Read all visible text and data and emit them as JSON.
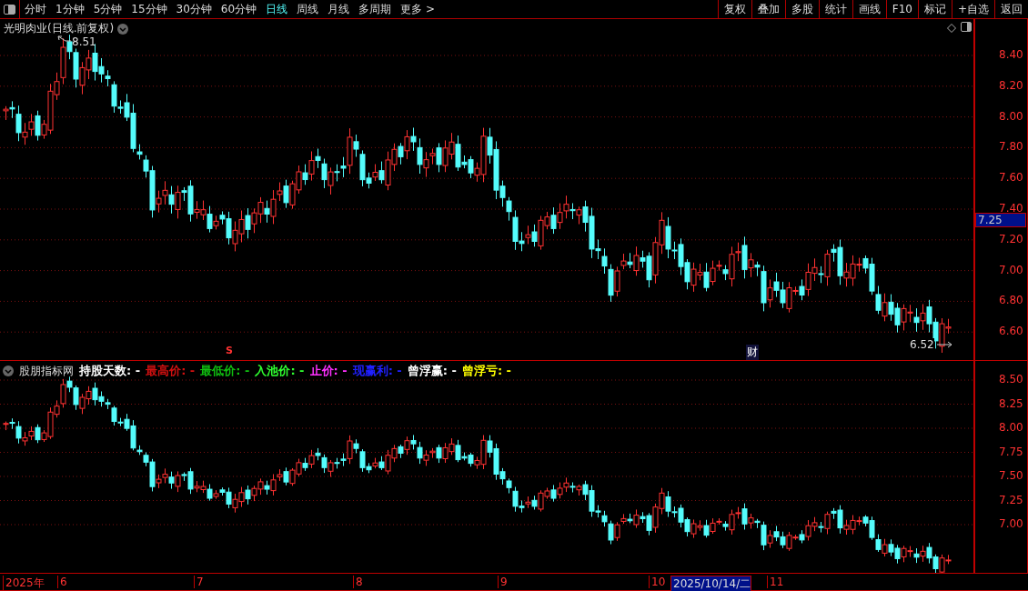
{
  "toolbar": {
    "periods": [
      {
        "label": "分时",
        "selected": false
      },
      {
        "label": "1分钟",
        "selected": false
      },
      {
        "label": "5分钟",
        "selected": false
      },
      {
        "label": "15分钟",
        "selected": false
      },
      {
        "label": "30分钟",
        "selected": false
      },
      {
        "label": "60分钟",
        "selected": false
      },
      {
        "label": "日线",
        "selected": true
      },
      {
        "label": "周线",
        "selected": false
      },
      {
        "label": "月线",
        "selected": false
      },
      {
        "label": "多周期",
        "selected": false
      },
      {
        "label": "更多 >",
        "selected": false
      }
    ],
    "buttons": [
      "复权",
      "叠加",
      "多股",
      "统计",
      "画线",
      "F10",
      "标记",
      "+自选",
      "返回"
    ]
  },
  "main_chart": {
    "title": "光明肉业(日线.前复权)",
    "high_label": "8.51",
    "low_label": "6.52",
    "axis_ticks": [
      "8.40",
      "8.20",
      "8.00",
      "7.80",
      "7.60",
      "7.40",
      "7.20",
      "7.00",
      "6.80",
      "6.60"
    ],
    "current_price": "7.25",
    "event_marks": [
      {
        "kind": "signal",
        "text": "S"
      },
      {
        "kind": "finance",
        "text": "财"
      }
    ]
  },
  "indicator": {
    "name": "股朋指标网",
    "fields": [
      {
        "label": "持股天数: -",
        "color": "#ffffff"
      },
      {
        "label": "最高价: -",
        "color": "#d01010"
      },
      {
        "label": "最低价: -",
        "color": "#10c010"
      },
      {
        "label": "入池价: -",
        "color": "#30ff30"
      },
      {
        "label": "止价: -",
        "color": "#ff30ff"
      },
      {
        "label": "现赢利: -",
        "color": "#2020ff"
      },
      {
        "label": "曾浮赢: -",
        "color": "#ffffff"
      },
      {
        "label": "曾浮亏: -",
        "color": "#ffff00"
      }
    ],
    "axis_ticks": [
      "8.50",
      "8.25",
      "8.00",
      "7.75",
      "7.50",
      "7.25",
      "7.00"
    ]
  },
  "date_axis": {
    "labels": [
      {
        "text": "2025年",
        "selected": false
      },
      {
        "text": "6",
        "selected": false
      },
      {
        "text": "7",
        "selected": false
      },
      {
        "text": "8",
        "selected": false
      },
      {
        "text": "9",
        "selected": false
      },
      {
        "text": "10",
        "selected": false
      },
      {
        "text": "2025/10/14/二",
        "selected": true
      },
      {
        "text": "11",
        "selected": false
      }
    ]
  }
}
